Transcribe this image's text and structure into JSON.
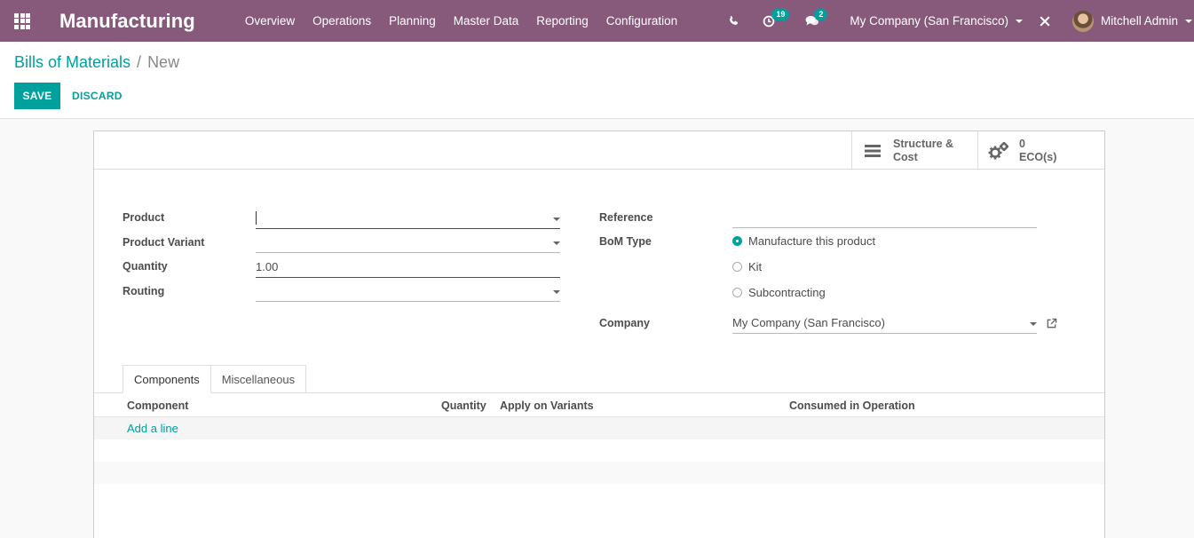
{
  "navbar": {
    "app_title": "Manufacturing",
    "menu": [
      "Overview",
      "Operations",
      "Planning",
      "Master Data",
      "Reporting",
      "Configuration"
    ],
    "activity_count": "19",
    "messages_count": "2",
    "company": "My Company (San Francisco)",
    "user": "Mitchell Admin",
    "accent_color": "#875a7b"
  },
  "breadcrumb": {
    "parent": "Bills of Materials",
    "separator": "/",
    "current": "New"
  },
  "actions": {
    "save": "SAVE",
    "discard": "DISCARD"
  },
  "button_box": {
    "structure_line1": "Structure &",
    "structure_line2": "Cost",
    "eco_count": "0",
    "eco_label": "ECO(s)"
  },
  "form": {
    "product_label": "Product",
    "product_value": "",
    "variant_label": "Product Variant",
    "variant_value": "",
    "quantity_label": "Quantity",
    "quantity_value": "1.00",
    "routing_label": "Routing",
    "routing_value": "",
    "reference_label": "Reference",
    "reference_value": "",
    "bom_type_label": "BoM Type",
    "bom_type_options": [
      "Manufacture this product",
      "Kit",
      "Subcontracting"
    ],
    "bom_type_selected": "Manufacture this product",
    "company_label": "Company",
    "company_value": "My Company (San Francisco)"
  },
  "tabs": {
    "components": "Components",
    "miscellaneous": "Miscellaneous",
    "active": "Components"
  },
  "table": {
    "headers": {
      "component": "Component",
      "quantity": "Quantity",
      "apply_on_variants": "Apply on Variants",
      "consumed_in_operation": "Consumed in Operation"
    },
    "add_line": "Add a line"
  },
  "colors": {
    "primary": "#00a09d",
    "brand": "#875a7b"
  }
}
